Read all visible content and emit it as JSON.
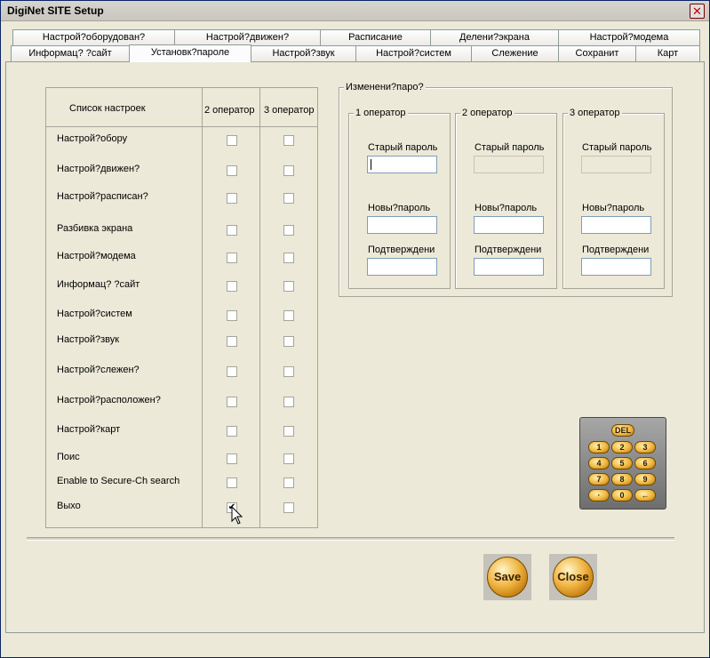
{
  "window": {
    "title": "DigiNet SITE Setup"
  },
  "tabs_row1": [
    "Настрой?оборудован?",
    "Настрой?движен?",
    "Расписание",
    "Делени?экрана",
    "Настрой?модема"
  ],
  "tabs_row2": [
    "Информац? ?сайт",
    "Установк?пароле",
    "Настрой?звук",
    "Настрой?систем",
    "Слежение",
    "Сохранит",
    "Карт"
  ],
  "settings_table": {
    "header": "Список настроек",
    "col2": "2 оператор",
    "col3": "3 оператор",
    "rows": [
      {
        "label": "Настрой?обору",
        "op2": false,
        "op3": false
      },
      {
        "label": "Настрой?движен?",
        "op2": false,
        "op3": false
      },
      {
        "label": "Настрой?расписан?",
        "op2": false,
        "op3": false
      },
      {
        "label": "Разбивка экрана",
        "op2": false,
        "op3": false
      },
      {
        "label": "Настрой?модема",
        "op2": false,
        "op3": false
      },
      {
        "label": "Информац? ?сайт",
        "op2": false,
        "op3": false
      },
      {
        "label": "Настрой?систем",
        "op2": false,
        "op3": false
      },
      {
        "label": "Настрой?звук",
        "op2": false,
        "op3": false
      },
      {
        "label": "Настрой?слежен?",
        "op2": false,
        "op3": false
      },
      {
        "label": "Настрой?расположен?",
        "op2": false,
        "op3": false
      },
      {
        "label": "Настрой?карт",
        "op2": false,
        "op3": false
      },
      {
        "label": "Поис",
        "op2": false,
        "op3": false
      },
      {
        "label": "Enable to Secure-Ch search",
        "op2": false,
        "op3": false
      },
      {
        "label": "Выхо",
        "op2": true,
        "op3": false
      }
    ]
  },
  "password_change": {
    "title": "Изменени?паро?",
    "operators": [
      {
        "title": "1 оператор",
        "old_label": "Старый пароль",
        "new_label": "Новы?пароль",
        "confirm_label": "Подтверждени",
        "old_value": "",
        "new_value": "",
        "confirm_value": "",
        "old_enabled": true
      },
      {
        "title": "2 оператор",
        "old_label": "Старый пароль",
        "new_label": "Новы?пароль",
        "confirm_label": "Подтверждени",
        "old_value": "",
        "new_value": "",
        "confirm_value": "",
        "old_enabled": false
      },
      {
        "title": "3 оператор",
        "old_label": "Старый пароль",
        "new_label": "Новы?пароль",
        "confirm_label": "Подтверждени",
        "old_value": "",
        "new_value": "",
        "confirm_value": "",
        "old_enabled": false
      }
    ]
  },
  "keypad": {
    "del": "DEL",
    "keys": [
      "1",
      "2",
      "3",
      "4",
      "5",
      "6",
      "7",
      "8",
      "9",
      "·",
      "0",
      "←"
    ]
  },
  "buttons": {
    "save": "Save",
    "close": "Close"
  },
  "checkmark": "✔"
}
